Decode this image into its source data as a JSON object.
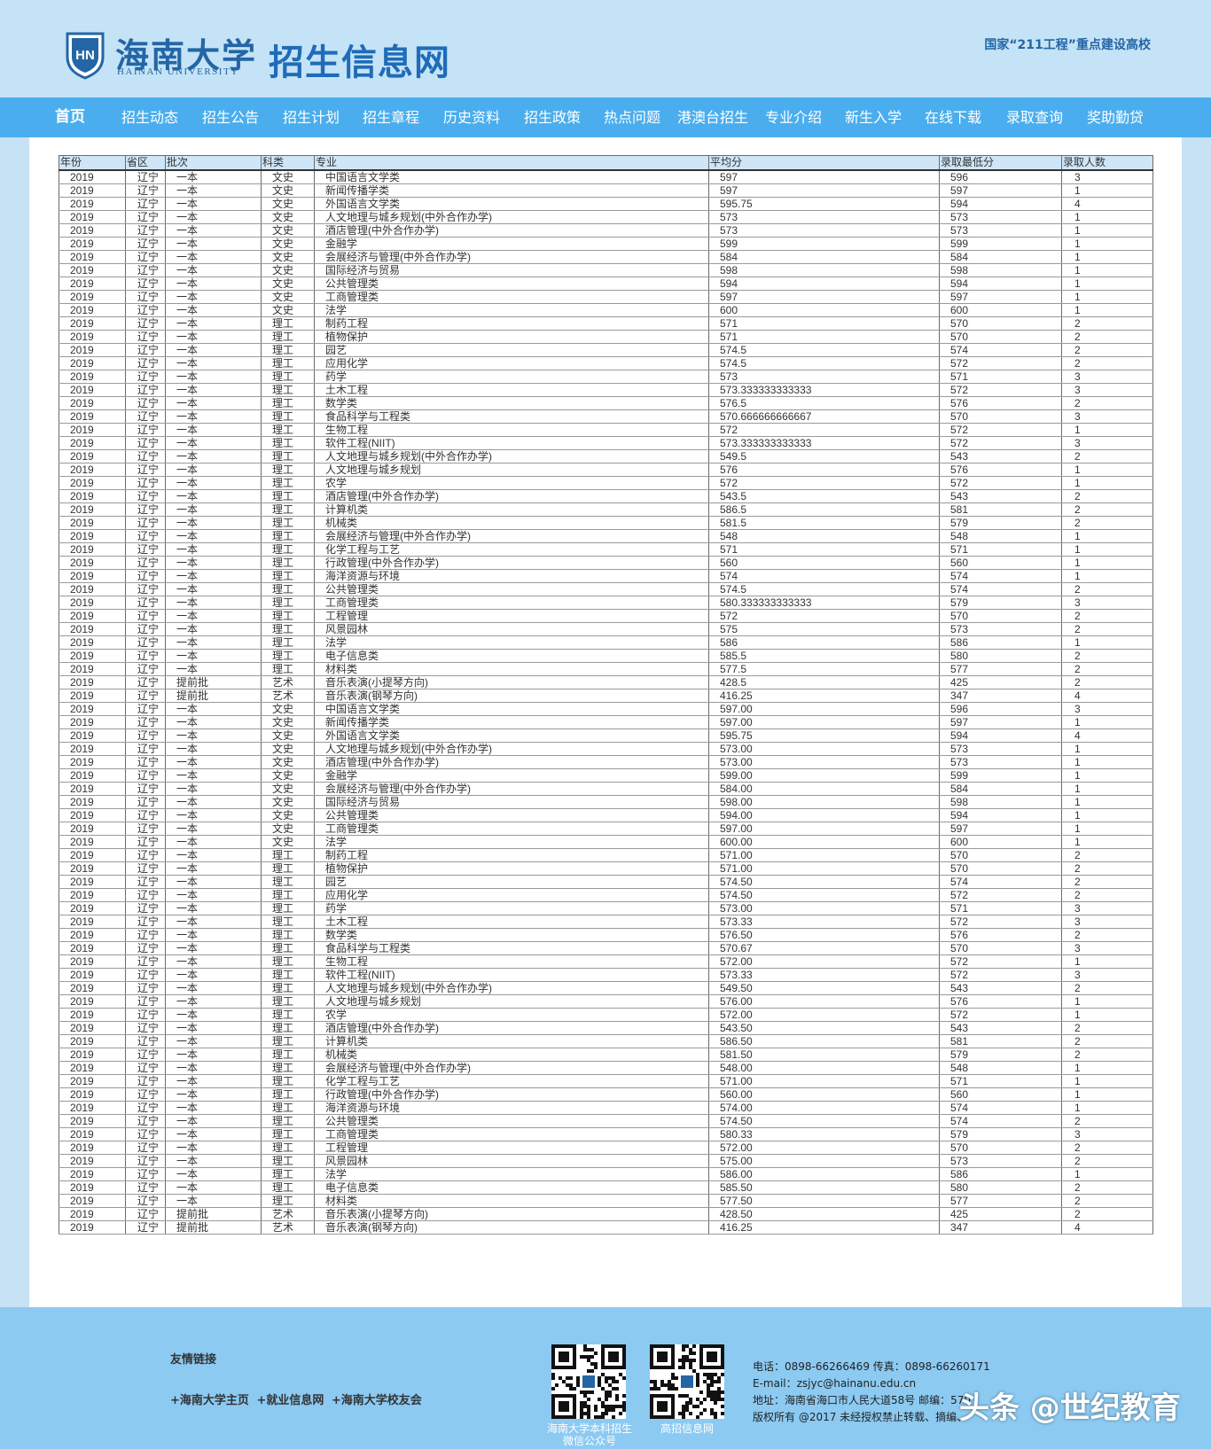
{
  "header": {
    "logo_cn": "海南大学",
    "logo_en": "HAINAN UNIVERSITY",
    "emblem_text": "HN",
    "site_title": "招生信息网",
    "tagline": "国家“211工程”重点建设高校"
  },
  "nav": [
    "首页",
    "招生动态",
    "招生公告",
    "招生计划",
    "招生章程",
    "历史资料",
    "招生政策",
    "热点问题",
    "港澳台招生",
    "专业介绍",
    "新生入学",
    "在线下载",
    "录取查询",
    "奖助勤贷"
  ],
  "table": {
    "headers": [
      "年份",
      "省区",
      "批次",
      "科类",
      "专业",
      "平均分",
      "录取最低分",
      "录取人数"
    ],
    "rows": [
      [
        "2019",
        "辽宁",
        "一本",
        "文史",
        "中国语言文学类",
        "597",
        "596",
        "3"
      ],
      [
        "2019",
        "辽宁",
        "一本",
        "文史",
        "新闻传播学类",
        "597",
        "597",
        "1"
      ],
      [
        "2019",
        "辽宁",
        "一本",
        "文史",
        "外国语言文学类",
        "595.75",
        "594",
        "4"
      ],
      [
        "2019",
        "辽宁",
        "一本",
        "文史",
        "人文地理与城乡规划(中外合作办学)",
        "573",
        "573",
        "1"
      ],
      [
        "2019",
        "辽宁",
        "一本",
        "文史",
        "酒店管理(中外合作办学)",
        "573",
        "573",
        "1"
      ],
      [
        "2019",
        "辽宁",
        "一本",
        "文史",
        "金融学",
        "599",
        "599",
        "1"
      ],
      [
        "2019",
        "辽宁",
        "一本",
        "文史",
        "会展经济与管理(中外合作办学)",
        "584",
        "584",
        "1"
      ],
      [
        "2019",
        "辽宁",
        "一本",
        "文史",
        "国际经济与贸易",
        "598",
        "598",
        "1"
      ],
      [
        "2019",
        "辽宁",
        "一本",
        "文史",
        "公共管理类",
        "594",
        "594",
        "1"
      ],
      [
        "2019",
        "辽宁",
        "一本",
        "文史",
        "工商管理类",
        "597",
        "597",
        "1"
      ],
      [
        "2019",
        "辽宁",
        "一本",
        "文史",
        "法学",
        "600",
        "600",
        "1"
      ],
      [
        "2019",
        "辽宁",
        "一本",
        "理工",
        "制药工程",
        "571",
        "570",
        "2"
      ],
      [
        "2019",
        "辽宁",
        "一本",
        "理工",
        "植物保护",
        "571",
        "570",
        "2"
      ],
      [
        "2019",
        "辽宁",
        "一本",
        "理工",
        "园艺",
        "574.5",
        "574",
        "2"
      ],
      [
        "2019",
        "辽宁",
        "一本",
        "理工",
        "应用化学",
        "574.5",
        "572",
        "2"
      ],
      [
        "2019",
        "辽宁",
        "一本",
        "理工",
        "药学",
        "573",
        "571",
        "3"
      ],
      [
        "2019",
        "辽宁",
        "一本",
        "理工",
        "土木工程",
        "573.333333333333",
        "572",
        "3"
      ],
      [
        "2019",
        "辽宁",
        "一本",
        "理工",
        "数学类",
        "576.5",
        "576",
        "2"
      ],
      [
        "2019",
        "辽宁",
        "一本",
        "理工",
        "食品科学与工程类",
        "570.666666666667",
        "570",
        "3"
      ],
      [
        "2019",
        "辽宁",
        "一本",
        "理工",
        "生物工程",
        "572",
        "572",
        "1"
      ],
      [
        "2019",
        "辽宁",
        "一本",
        "理工",
        "软件工程(NIIT)",
        "573.333333333333",
        "572",
        "3"
      ],
      [
        "2019",
        "辽宁",
        "一本",
        "理工",
        "人文地理与城乡规划(中外合作办学)",
        "549.5",
        "543",
        "2"
      ],
      [
        "2019",
        "辽宁",
        "一本",
        "理工",
        "人文地理与城乡规划",
        "576",
        "576",
        "1"
      ],
      [
        "2019",
        "辽宁",
        "一本",
        "理工",
        "农学",
        "572",
        "572",
        "1"
      ],
      [
        "2019",
        "辽宁",
        "一本",
        "理工",
        "酒店管理(中外合作办学)",
        "543.5",
        "543",
        "2"
      ],
      [
        "2019",
        "辽宁",
        "一本",
        "理工",
        "计算机类",
        "586.5",
        "581",
        "2"
      ],
      [
        "2019",
        "辽宁",
        "一本",
        "理工",
        "机械类",
        "581.5",
        "579",
        "2"
      ],
      [
        "2019",
        "辽宁",
        "一本",
        "理工",
        "会展经济与管理(中外合作办学)",
        "548",
        "548",
        "1"
      ],
      [
        "2019",
        "辽宁",
        "一本",
        "理工",
        "化学工程与工艺",
        "571",
        "571",
        "1"
      ],
      [
        "2019",
        "辽宁",
        "一本",
        "理工",
        "行政管理(中外合作办学)",
        "560",
        "560",
        "1"
      ],
      [
        "2019",
        "辽宁",
        "一本",
        "理工",
        "海洋资源与环境",
        "574",
        "574",
        "1"
      ],
      [
        "2019",
        "辽宁",
        "一本",
        "理工",
        "公共管理类",
        "574.5",
        "574",
        "2"
      ],
      [
        "2019",
        "辽宁",
        "一本",
        "理工",
        "工商管理类",
        "580.333333333333",
        "579",
        "3"
      ],
      [
        "2019",
        "辽宁",
        "一本",
        "理工",
        "工程管理",
        "572",
        "570",
        "2"
      ],
      [
        "2019",
        "辽宁",
        "一本",
        "理工",
        "风景园林",
        "575",
        "573",
        "2"
      ],
      [
        "2019",
        "辽宁",
        "一本",
        "理工",
        "法学",
        "586",
        "586",
        "1"
      ],
      [
        "2019",
        "辽宁",
        "一本",
        "理工",
        "电子信息类",
        "585.5",
        "580",
        "2"
      ],
      [
        "2019",
        "辽宁",
        "一本",
        "理工",
        "材料类",
        "577.5",
        "577",
        "2"
      ],
      [
        "2019",
        "辽宁",
        "提前批",
        "艺术",
        "音乐表演(小提琴方向)",
        "428.5",
        "425",
        "2"
      ],
      [
        "2019",
        "辽宁",
        "提前批",
        "艺术",
        "音乐表演(钢琴方向)",
        "416.25",
        "347",
        "4"
      ],
      [
        "2019",
        "辽宁",
        "一本",
        "文史",
        "中国语言文学类",
        "597.00",
        "596",
        "3"
      ],
      [
        "2019",
        "辽宁",
        "一本",
        "文史",
        "新闻传播学类",
        "597.00",
        "597",
        "1"
      ],
      [
        "2019",
        "辽宁",
        "一本",
        "文史",
        "外国语言文学类",
        "595.75",
        "594",
        "4"
      ],
      [
        "2019",
        "辽宁",
        "一本",
        "文史",
        "人文地理与城乡规划(中外合作办学)",
        "573.00",
        "573",
        "1"
      ],
      [
        "2019",
        "辽宁",
        "一本",
        "文史",
        "酒店管理(中外合作办学)",
        "573.00",
        "573",
        "1"
      ],
      [
        "2019",
        "辽宁",
        "一本",
        "文史",
        "金融学",
        "599.00",
        "599",
        "1"
      ],
      [
        "2019",
        "辽宁",
        "一本",
        "文史",
        "会展经济与管理(中外合作办学)",
        "584.00",
        "584",
        "1"
      ],
      [
        "2019",
        "辽宁",
        "一本",
        "文史",
        "国际经济与贸易",
        "598.00",
        "598",
        "1"
      ],
      [
        "2019",
        "辽宁",
        "一本",
        "文史",
        "公共管理类",
        "594.00",
        "594",
        "1"
      ],
      [
        "2019",
        "辽宁",
        "一本",
        "文史",
        "工商管理类",
        "597.00",
        "597",
        "1"
      ],
      [
        "2019",
        "辽宁",
        "一本",
        "文史",
        "法学",
        "600.00",
        "600",
        "1"
      ],
      [
        "2019",
        "辽宁",
        "一本",
        "理工",
        "制药工程",
        "571.00",
        "570",
        "2"
      ],
      [
        "2019",
        "辽宁",
        "一本",
        "理工",
        "植物保护",
        "571.00",
        "570",
        "2"
      ],
      [
        "2019",
        "辽宁",
        "一本",
        "理工",
        "园艺",
        "574.50",
        "574",
        "2"
      ],
      [
        "2019",
        "辽宁",
        "一本",
        "理工",
        "应用化学",
        "574.50",
        "572",
        "2"
      ],
      [
        "2019",
        "辽宁",
        "一本",
        "理工",
        "药学",
        "573.00",
        "571",
        "3"
      ],
      [
        "2019",
        "辽宁",
        "一本",
        "理工",
        "土木工程",
        "573.33",
        "572",
        "3"
      ],
      [
        "2019",
        "辽宁",
        "一本",
        "理工",
        "数学类",
        "576.50",
        "576",
        "2"
      ],
      [
        "2019",
        "辽宁",
        "一本",
        "理工",
        "食品科学与工程类",
        "570.67",
        "570",
        "3"
      ],
      [
        "2019",
        "辽宁",
        "一本",
        "理工",
        "生物工程",
        "572.00",
        "572",
        "1"
      ],
      [
        "2019",
        "辽宁",
        "一本",
        "理工",
        "软件工程(NIIT)",
        "573.33",
        "572",
        "3"
      ],
      [
        "2019",
        "辽宁",
        "一本",
        "理工",
        "人文地理与城乡规划(中外合作办学)",
        "549.50",
        "543",
        "2"
      ],
      [
        "2019",
        "辽宁",
        "一本",
        "理工",
        "人文地理与城乡规划",
        "576.00",
        "576",
        "1"
      ],
      [
        "2019",
        "辽宁",
        "一本",
        "理工",
        "农学",
        "572.00",
        "572",
        "1"
      ],
      [
        "2019",
        "辽宁",
        "一本",
        "理工",
        "酒店管理(中外合作办学)",
        "543.50",
        "543",
        "2"
      ],
      [
        "2019",
        "辽宁",
        "一本",
        "理工",
        "计算机类",
        "586.50",
        "581",
        "2"
      ],
      [
        "2019",
        "辽宁",
        "一本",
        "理工",
        "机械类",
        "581.50",
        "579",
        "2"
      ],
      [
        "2019",
        "辽宁",
        "一本",
        "理工",
        "会展经济与管理(中外合作办学)",
        "548.00",
        "548",
        "1"
      ],
      [
        "2019",
        "辽宁",
        "一本",
        "理工",
        "化学工程与工艺",
        "571.00",
        "571",
        "1"
      ],
      [
        "2019",
        "辽宁",
        "一本",
        "理工",
        "行政管理(中外合作办学)",
        "560.00",
        "560",
        "1"
      ],
      [
        "2019",
        "辽宁",
        "一本",
        "理工",
        "海洋资源与环境",
        "574.00",
        "574",
        "1"
      ],
      [
        "2019",
        "辽宁",
        "一本",
        "理工",
        "公共管理类",
        "574.50",
        "574",
        "2"
      ],
      [
        "2019",
        "辽宁",
        "一本",
        "理工",
        "工商管理类",
        "580.33",
        "579",
        "3"
      ],
      [
        "2019",
        "辽宁",
        "一本",
        "理工",
        "工程管理",
        "572.00",
        "570",
        "2"
      ],
      [
        "2019",
        "辽宁",
        "一本",
        "理工",
        "风景园林",
        "575.00",
        "573",
        "2"
      ],
      [
        "2019",
        "辽宁",
        "一本",
        "理工",
        "法学",
        "586.00",
        "586",
        "1"
      ],
      [
        "2019",
        "辽宁",
        "一本",
        "理工",
        "电子信息类",
        "585.50",
        "580",
        "2"
      ],
      [
        "2019",
        "辽宁",
        "一本",
        "理工",
        "材料类",
        "577.50",
        "577",
        "2"
      ],
      [
        "2019",
        "辽宁",
        "提前批",
        "艺术",
        "音乐表演(小提琴方向)",
        "428.50",
        "425",
        "2"
      ],
      [
        "2019",
        "辽宁",
        "提前批",
        "艺术",
        "音乐表演(钢琴方向)",
        "416.25",
        "347",
        "4"
      ]
    ]
  },
  "footer": {
    "links_title": "友情链接",
    "links": [
      "+海南大学主页",
      "+就业信息网",
      "+海南大学校友会"
    ],
    "qr1_label": [
      "海南大学本科招生",
      "微信公众号"
    ],
    "qr2_label": [
      "高招信息网"
    ],
    "contact": [
      "电话：0898-66266469 传真：0898-66260171",
      "E-mail：zsjyc@hainanu.edu.cn",
      "地址：海南省海口市人民大道58号 邮编：570",
      "版权所有 @2017 未经授权禁止转载、摘编、"
    ],
    "watermark": "头条 @世纪教育"
  },
  "colors": {
    "header_bg": "#c5e3f7",
    "nav_bg": "#4aaeee",
    "brand_blue": "#1f6cb8",
    "table_header_bg": "#cfe6f8",
    "footer_bg": "#8ccaf2"
  }
}
